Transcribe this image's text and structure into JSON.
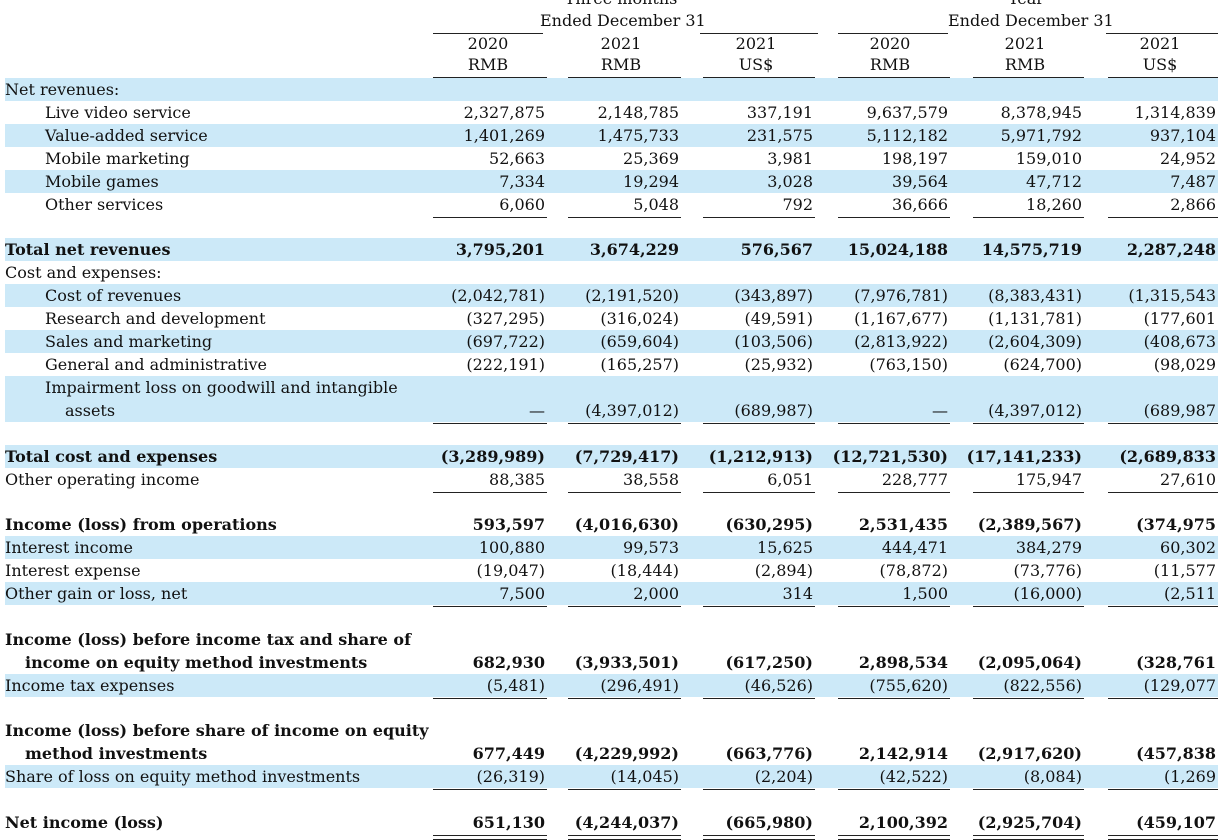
{
  "header": {
    "group1_top": "Three months",
    "group1_bottom": "Ended December 31",
    "group2_top": "Year",
    "group2_bottom": "Ended December 31",
    "columns": [
      {
        "year": "2020",
        "currency": "RMB"
      },
      {
        "year": "2021",
        "currency": "RMB"
      },
      {
        "year": "2021",
        "currency": "US$"
      },
      {
        "year": "2020",
        "currency": "RMB"
      },
      {
        "year": "2021",
        "currency": "RMB"
      },
      {
        "year": "2021",
        "currency": "US$"
      }
    ]
  },
  "rows": [
    {
      "label": "Net revenues:",
      "values": []
    },
    {
      "label": "Live video service",
      "values": [
        "2,327,875",
        "2,148,785",
        "337,191",
        "9,637,579",
        "8,378,945",
        "1,314,839"
      ]
    },
    {
      "label": "Value-added service",
      "values": [
        "1,401,269",
        "1,475,733",
        "231,575",
        "5,112,182",
        "5,971,792",
        "937,104"
      ]
    },
    {
      "label": "Mobile marketing",
      "values": [
        "52,663",
        "25,369",
        "3,981",
        "198,197",
        "159,010",
        "24,952"
      ]
    },
    {
      "label": "Mobile games",
      "values": [
        "7,334",
        "19,294",
        "3,028",
        "39,564",
        "47,712",
        "7,487"
      ]
    },
    {
      "label": "Other services",
      "values": [
        "6,060",
        "5,048",
        "792",
        "36,666",
        "18,260",
        "2,866"
      ]
    },
    {
      "label": "Total net revenues",
      "values": [
        "3,795,201",
        "3,674,229",
        "576,567",
        "15,024,188",
        "14,575,719",
        "2,287,248"
      ]
    },
    {
      "label": "Cost and expenses:",
      "values": []
    },
    {
      "label": "Cost of revenues",
      "values": [
        "(2,042,781)",
        "(2,191,520)",
        "(343,897)",
        "(7,976,781)",
        "(8,383,431)",
        "(1,315,543"
      ]
    },
    {
      "label": "Research and development",
      "values": [
        "(327,295)",
        "(316,024)",
        "(49,591)",
        "(1,167,677)",
        "(1,131,781)",
        "(177,601"
      ]
    },
    {
      "label": "Sales and marketing",
      "values": [
        "(697,722)",
        "(659,604)",
        "(103,506)",
        "(2,813,922)",
        "(2,604,309)",
        "(408,673"
      ]
    },
    {
      "label": "General and administrative",
      "values": [
        "(222,191)",
        "(165,257)",
        "(25,932)",
        "(763,150)",
        "(624,700)",
        "(98,029"
      ]
    },
    {
      "label": "Impairment loss on goodwill and intangible",
      "label2": "assets",
      "values": [
        "—",
        "(4,397,012)",
        "(689,987)",
        "—",
        "(4,397,012)",
        "(689,987"
      ]
    },
    {
      "label": "Total cost and expenses",
      "values": [
        "(3,289,989)",
        "(7,729,417)",
        "(1,212,913)",
        "(12,721,530)",
        "(17,141,233)",
        "(2,689,833"
      ]
    },
    {
      "label": "Other operating income",
      "values": [
        "88,385",
        "38,558",
        "6,051",
        "228,777",
        "175,947",
        "27,610"
      ]
    },
    {
      "label": "Income (loss) from operations",
      "values": [
        "593,597",
        "(4,016,630)",
        "(630,295)",
        "2,531,435",
        "(2,389,567)",
        "(374,975"
      ]
    },
    {
      "label": "Interest income",
      "values": [
        "100,880",
        "99,573",
        "15,625",
        "444,471",
        "384,279",
        "60,302"
      ]
    },
    {
      "label": "Interest expense",
      "values": [
        "(19,047)",
        "(18,444)",
        "(2,894)",
        "(78,872)",
        "(73,776)",
        "(11,577"
      ]
    },
    {
      "label": "Other gain or loss, net",
      "values": [
        "7,500",
        "2,000",
        "314",
        "1,500",
        "(16,000)",
        "(2,511"
      ]
    },
    {
      "label": "Income (loss) before income tax and share of",
      "label2": "income on equity method investments",
      "values": [
        "682,930",
        "(3,933,501)",
        "(617,250)",
        "2,898,534",
        "(2,095,064)",
        "(328,761"
      ]
    },
    {
      "label": "Income tax expenses",
      "values": [
        "(5,481)",
        "(296,491)",
        "(46,526)",
        "(755,620)",
        "(822,556)",
        "(129,077"
      ]
    },
    {
      "label": "Income (loss) before share of income on equity",
      "label2": "method investments",
      "values": [
        "677,449",
        "(4,229,992)",
        "(663,776)",
        "2,142,914",
        "(2,917,620)",
        "(457,838"
      ]
    },
    {
      "label": "Share of loss on equity method investments",
      "values": [
        "(26,319)",
        "(14,045)",
        "(2,204)",
        "(42,522)",
        "(8,084)",
        "(1,269"
      ]
    },
    {
      "label": "Net income (loss)",
      "values": [
        "651,130",
        "(4,244,037)",
        "(665,980)",
        "2,100,392",
        "(2,925,704)",
        "(459,107"
      ]
    }
  ]
}
